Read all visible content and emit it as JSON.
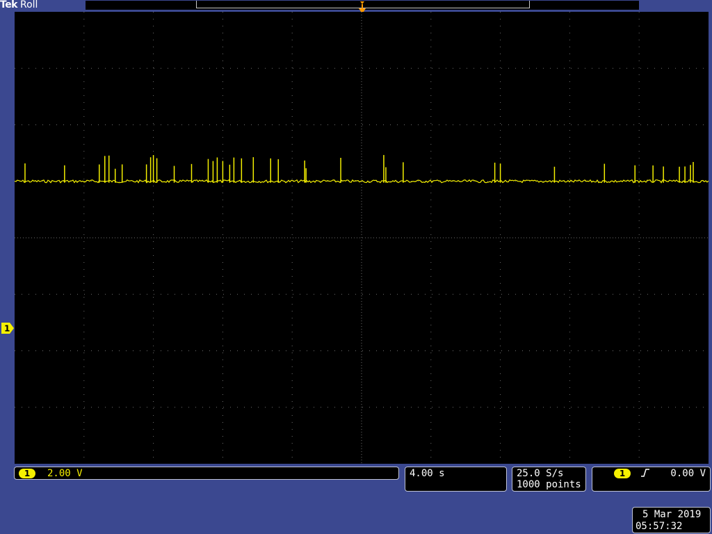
{
  "header": {
    "brand": "Tek",
    "mode": "Roll"
  },
  "channel": {
    "number": "1",
    "scale": "2.00 V"
  },
  "horizontal": {
    "scale": "4.00 s"
  },
  "acquisition": {
    "sample_rate": "25.0 S/s",
    "record_length": "1000 points"
  },
  "trigger": {
    "source": "1",
    "slope": "rising",
    "level": "0.00 V"
  },
  "datetime": {
    "date": "5 Mar 2019",
    "time": "05:57:32"
  },
  "colors": {
    "trace": "#f5f000",
    "background": "#3b4890",
    "graticule": "#6f6f6f",
    "screen": "#000000"
  },
  "icons": {
    "trigger_position": "trigger-position-marker-icon",
    "channel_ground": "channel-1-ground-marker-icon",
    "trigger_slope": "rising-edge-icon"
  },
  "chart_data": {
    "type": "line",
    "series": [
      {
        "channel": "1",
        "baseline_div": 1.0,
        "spikes_x_div": [
          0.15,
          0.72,
          1.22,
          1.3,
          1.36,
          1.45,
          1.55,
          1.9,
          1.96,
          2.0,
          2.05,
          2.3,
          2.55,
          2.79,
          2.86,
          2.92,
          3.0,
          3.1,
          3.16,
          3.27,
          3.44,
          3.69,
          3.8,
          4.18,
          4.2,
          4.7,
          5.32,
          5.35,
          5.6,
          6.92,
          7.0,
          7.78,
          8.5,
          8.94,
          9.2,
          9.35,
          9.58,
          9.66,
          9.74,
          9.78
        ]
      }
    ],
    "x_divisions": 10,
    "y_divisions": 8,
    "grid": true
  }
}
